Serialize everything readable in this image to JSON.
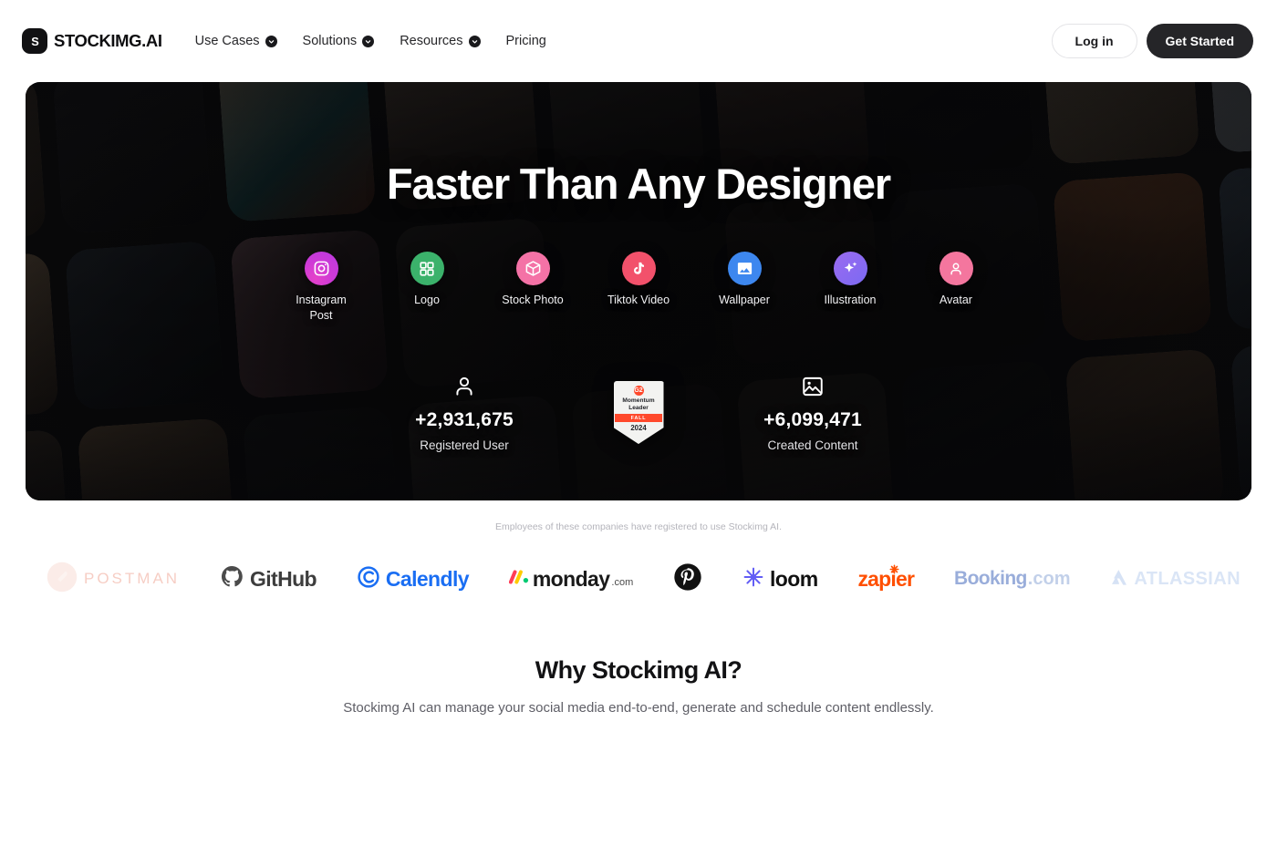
{
  "header": {
    "brand_mark": "s-logo-icon",
    "brand_name": "STOCKIMG.AI",
    "nav": [
      {
        "label": "Use Cases",
        "has_caret": true
      },
      {
        "label": "Solutions",
        "has_caret": true
      },
      {
        "label": "Resources",
        "has_caret": true
      },
      {
        "label": "Pricing",
        "has_caret": false
      }
    ],
    "login_label": "Log in",
    "get_started_label": "Get Started"
  },
  "hero": {
    "title": "Faster Than Any Designer",
    "categories": [
      {
        "label": "Instagram Post",
        "icon": "instagram-icon",
        "color": "#cf3ad6"
      },
      {
        "label": "Logo",
        "icon": "grid-squares-icon",
        "color": "#3bb26b"
      },
      {
        "label": "Stock Photo",
        "icon": "box-3d-icon",
        "color": "#f472a6"
      },
      {
        "label": "Tiktok Video",
        "icon": "tiktok-icon",
        "color": "#f2516b"
      },
      {
        "label": "Wallpaper",
        "icon": "image-icon",
        "color": "#3d87ef"
      },
      {
        "label": "Illustration",
        "icon": "sparkles-icon",
        "color": "#8b6af1"
      },
      {
        "label": "Avatar",
        "icon": "person-icon",
        "color": "#f4769e"
      }
    ],
    "stats": [
      {
        "icon": "person-icon",
        "value": "+2,931,675",
        "label": "Registered User"
      },
      {
        "icon": "image-icon",
        "value": "+6,099,471",
        "label": "Created Content"
      }
    ],
    "badge": {
      "mark": "G2",
      "title": "Momentum\nLeader",
      "title_line1": "Momentum",
      "title_line2": "Leader",
      "season": "FALL",
      "year": "2024"
    }
  },
  "social_proof": {
    "note": "Employees of these companies have registered to use Stockimg AI.",
    "logos": [
      {
        "name": "Postman",
        "text": "POSTMAN",
        "color": "#f5b3a6",
        "faded": true
      },
      {
        "name": "GitHub",
        "text": "GitHub",
        "color": "#4b4b4b",
        "faded": false
      },
      {
        "name": "Calendly",
        "text": "Calendly",
        "color": "#1a6ef3",
        "faded": false
      },
      {
        "name": "monday.com",
        "text": "monday",
        "suffix": ".com",
        "color": "#1a1a1a",
        "faded": false
      },
      {
        "name": "Pinterest",
        "text": "",
        "color": "#111111",
        "faded": false
      },
      {
        "name": "loom",
        "text": "loom",
        "color": "#111111",
        "faded": false
      },
      {
        "name": "zapier",
        "text": "zapier",
        "color": "#ff4f00",
        "faded": false
      },
      {
        "name": "Booking.com",
        "text": "Booking",
        "suffix": ".com",
        "color": "#7a8fc4",
        "faded": true
      },
      {
        "name": "Atlassian",
        "text": "ATLASSIAN",
        "color": "#c2d3ee",
        "faded": true
      }
    ]
  },
  "why": {
    "title": "Why Stockimg AI?",
    "subtitle": "Stockimg AI can manage your social media end-to-end, generate and schedule content endlessly."
  }
}
